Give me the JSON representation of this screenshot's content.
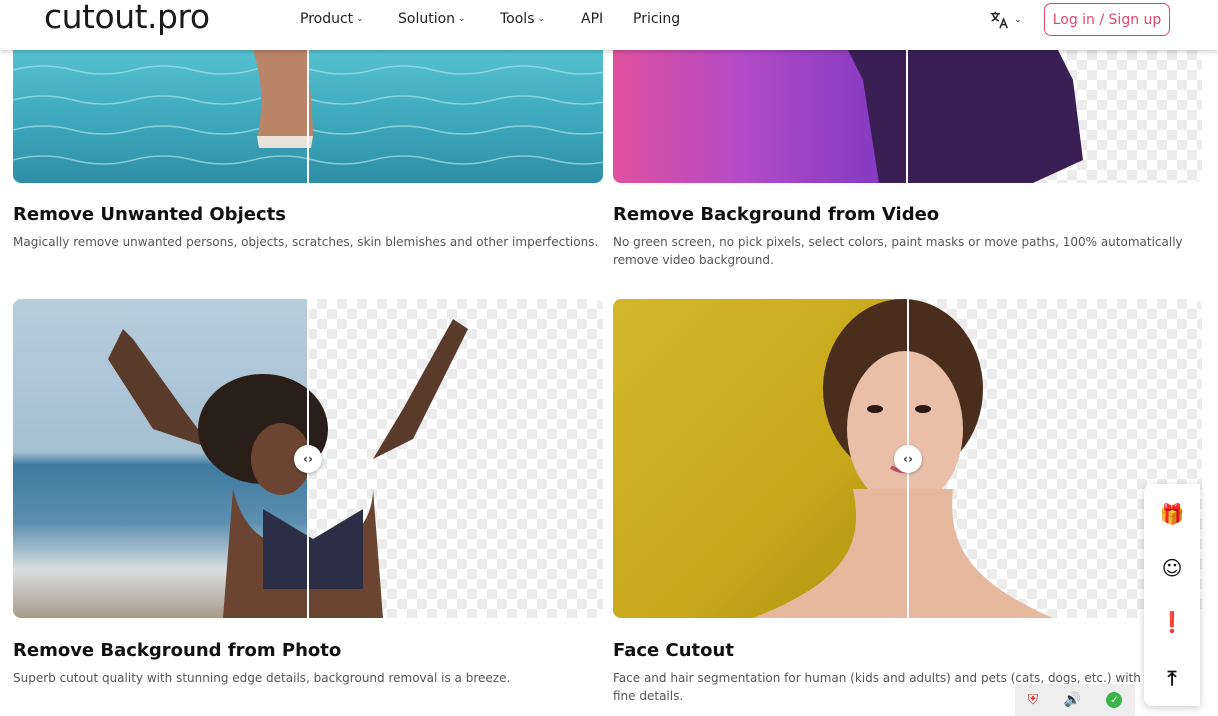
{
  "header": {
    "logo": "cutout.pro",
    "nav": [
      {
        "label": "Product",
        "has_dropdown": true
      },
      {
        "label": "Solution",
        "has_dropdown": true
      },
      {
        "label": "Tools",
        "has_dropdown": true
      },
      {
        "label": "API",
        "has_dropdown": false
      },
      {
        "label": "Pricing",
        "has_dropdown": false
      }
    ],
    "language_icon": "translate-icon",
    "login_label": "Log in / Sign up"
  },
  "cards": [
    {
      "title": "Remove Unwanted Objects",
      "description": "Magically remove unwanted persons, objects, scratches, skin blemishes and other imperfections."
    },
    {
      "title": "Remove Background from Video",
      "description": "No green screen, no pick pixels, select colors, paint masks or move paths, 100% automatically remove video background."
    },
    {
      "title": "Remove Background from Photo",
      "description": "Superb cutout quality with stunning edge details, background removal is a breeze."
    },
    {
      "title": "Face Cutout",
      "description": "Face and hair segmentation for human (kids and adults) and pets (cats, dogs, etc.) with fine details."
    }
  ],
  "compare_handle": {
    "left": "‹",
    "right": "›"
  },
  "side_panel": [
    {
      "icon": "gift-icon",
      "glyph": "🎁"
    },
    {
      "icon": "support-agent-icon",
      "glyph": "☺"
    },
    {
      "icon": "feedback-icon",
      "glyph": "❗"
    },
    {
      "icon": "back-to-top-icon",
      "glyph": "⤒"
    }
  ],
  "tray": [
    {
      "icon": "shield-icon",
      "glyph": "⛨"
    },
    {
      "icon": "speaker-icon",
      "glyph": "🔊"
    },
    {
      "icon": "check-icon",
      "glyph": "✓"
    }
  ],
  "colors": {
    "accent": "#e0476f",
    "water": "#4fb6c8",
    "video_bg": "#c44fd0",
    "sky": "#a9c4d8",
    "yellow_bg": "#c9a81a"
  }
}
